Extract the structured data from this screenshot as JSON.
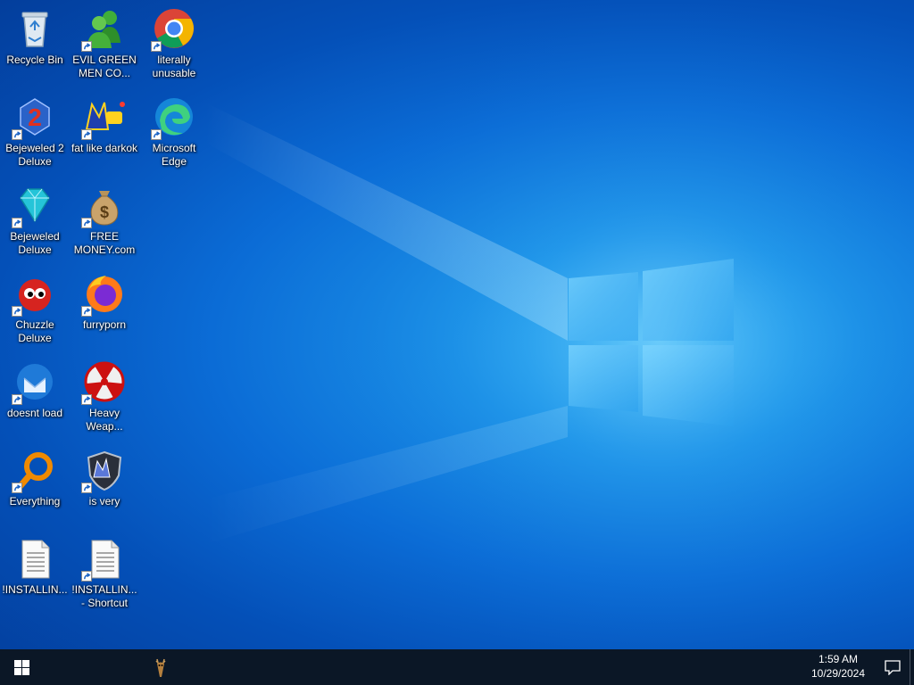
{
  "desktop": {
    "icons": [
      {
        "label": "Recycle Bin",
        "icon": "recycle-bin-icon"
      },
      {
        "label": "EVIL GREEN MEN CO...",
        "icon": "messenger-people-icon"
      },
      {
        "label": "literally unusable",
        "icon": "chrome-icon"
      },
      {
        "label": "Bejeweled 2 Deluxe",
        "icon": "bejeweled-2-icon"
      },
      {
        "label": "fat like darkok",
        "icon": "mpi-logo-icon"
      },
      {
        "label": "Microsoft Edge",
        "icon": "edge-icon"
      },
      {
        "label": "Bejeweled Deluxe",
        "icon": "gem-icon"
      },
      {
        "label": "FREE MONEY.com",
        "icon": "money-bag-icon"
      },
      {
        "label": "Chuzzle Deluxe",
        "icon": "chuzzle-icon"
      },
      {
        "label": "furryporn",
        "icon": "firefox-icon"
      },
      {
        "label": "doesnt load",
        "icon": "thunderbird-icon"
      },
      {
        "label": "Heavy Weap...",
        "icon": "radiation-icon"
      },
      {
        "label": "Everything",
        "icon": "everything-search-icon"
      },
      {
        "label": "is very",
        "icon": "mpi-shield-icon"
      },
      {
        "label": "!INSTALLIN...",
        "icon": "text-file-icon"
      },
      {
        "label": "!INSTALLIN... - Shortcut",
        "icon": "text-file-icon"
      }
    ]
  },
  "taskbar": {
    "start_icon": "windows-logo-icon",
    "app_icon": "deer-app-icon",
    "clock": {
      "time": "1:59 AM",
      "date": "10/29/2024"
    },
    "notification_icon": "action-center-icon"
  },
  "colors": {
    "taskbar": "#0b1726",
    "wallpaper_accent": "#1a8fe6"
  }
}
